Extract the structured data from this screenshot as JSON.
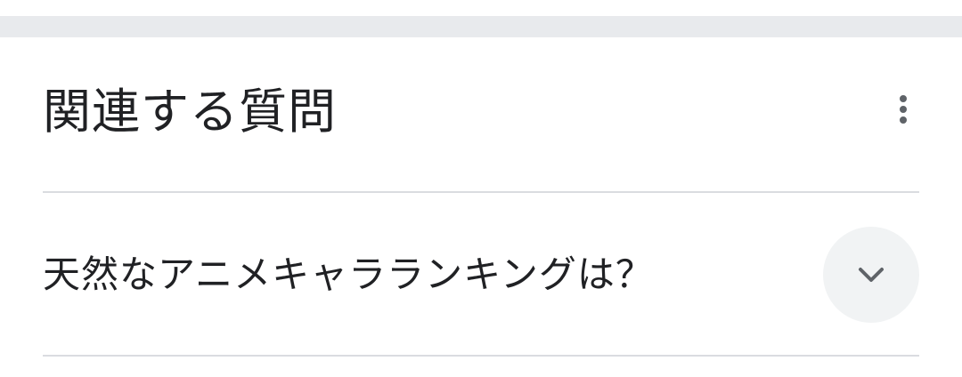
{
  "related_questions": {
    "title": "関連する質問",
    "more_icon": "more-vert-icon",
    "items": [
      {
        "question": "天然なアニメキャラランキングは？",
        "expand_icon": "chevron-down-icon",
        "expanded": false
      }
    ]
  },
  "colors": {
    "text": "#202124",
    "divider": "#dadce0",
    "band": "#e8eaed",
    "icon": "#5f6368",
    "button_bg": "#f1f3f4"
  }
}
